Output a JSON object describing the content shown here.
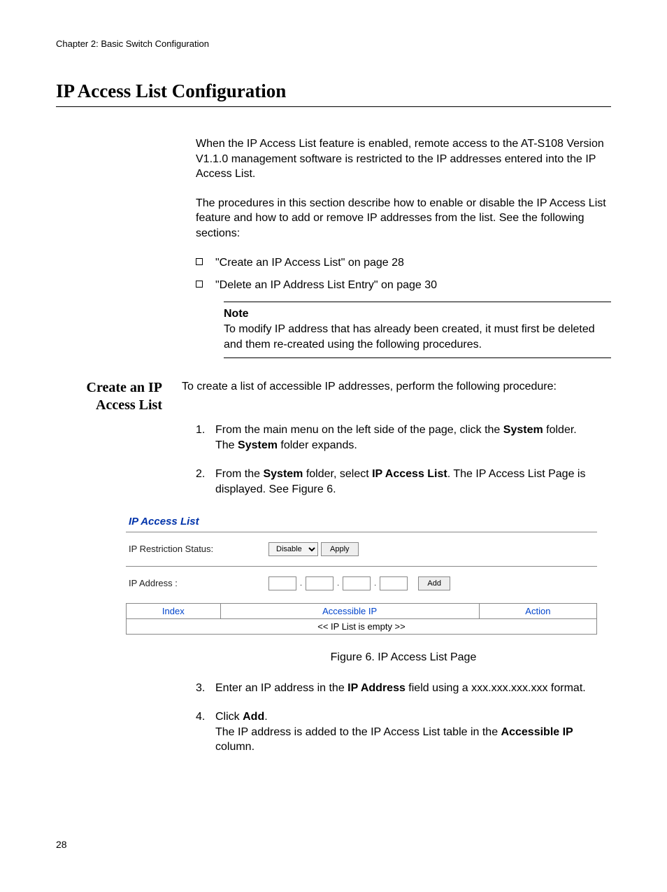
{
  "chapter": "Chapter 2: Basic Switch Configuration",
  "title": "IP Access List Configuration",
  "para1": "When the IP Access List feature is enabled, remote access to the AT-S108 Version V1.1.0 management software is restricted to the IP addresses entered into the IP Access List.",
  "para2": "The procedures in this section describe how to enable or disable the IP Access List feature and how to add or remove IP addresses from the list. See the following sections:",
  "bullets": [
    "\"Create an IP Access List\" on page 28",
    "\"Delete an IP Address List Entry\" on page 30"
  ],
  "note": {
    "label": "Note",
    "text": "To modify IP address that has already been created, it must first be deleted and them re-created using the following procedures."
  },
  "section_head": "Create an IP Access List",
  "section_intro": "To create a list of accessible IP addresses, perform the following procedure:",
  "step1": {
    "pre": "From the main menu on the left side of the page, click the ",
    "bold1": "System",
    "mid": " folder.",
    "line2a": "The ",
    "bold2": "System",
    "line2b": " folder expands."
  },
  "step2": {
    "pre": "From the ",
    "bold1": "System",
    "mid": " folder, select ",
    "bold2": "IP Access List",
    "post": ". The IP Access List Page is displayed. See Figure 6."
  },
  "panel": {
    "title": "IP Access List",
    "restriction_label": "IP Restriction Status:",
    "restriction_value": "Disable",
    "apply_label": "Apply",
    "ip_label": "IP Address :",
    "add_label": "Add",
    "th_index": "Index",
    "th_accessible": "Accessible IP",
    "th_action": "Action",
    "empty": "<< IP List is empty >>"
  },
  "figure_caption": "Figure 6. IP Access List Page",
  "step3": {
    "pre": "Enter an IP address in the ",
    "bold": "IP Address",
    "post": " field using a xxx.xxx.xxx.xxx format."
  },
  "step4": {
    "pre": "Click ",
    "bold1": "Add",
    "post1": ".",
    "line2a": "The IP address is added to the IP Access List table in the ",
    "bold2": "Accessible IP",
    "line2b": " column."
  },
  "page_number": "28"
}
